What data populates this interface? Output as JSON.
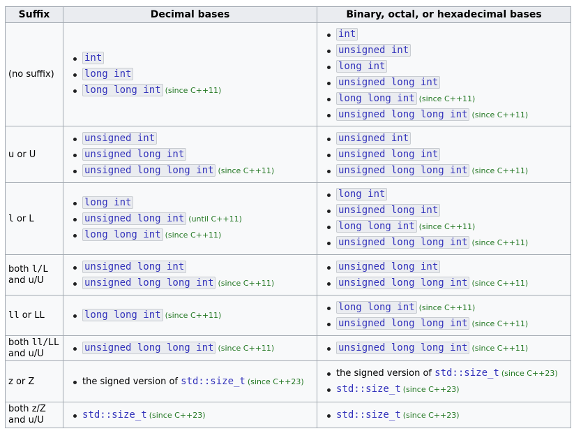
{
  "header": {
    "suffix": "Suffix",
    "decimal": "Decimal bases",
    "other": "Binary, octal, or hexadecimal bases"
  },
  "rows": [
    {
      "suffix_text": "(no suffix)",
      "decimal": [
        {
          "code": "int"
        },
        {
          "code": "long int"
        },
        {
          "code": "long long int",
          "note": "(since C++11)"
        }
      ],
      "other": [
        {
          "code": "int"
        },
        {
          "code": "unsigned int"
        },
        {
          "code": "long int"
        },
        {
          "code": "unsigned long int"
        },
        {
          "code": "long long int",
          "note": "(since C++11)"
        },
        {
          "code": "unsigned long long int",
          "note": "(since C++11)"
        }
      ]
    },
    {
      "suffix_text": "u or U",
      "decimal": [
        {
          "code": "unsigned int"
        },
        {
          "code": "unsigned long int"
        },
        {
          "code": "unsigned long long int",
          "note": "(since C++11)"
        }
      ],
      "other": [
        {
          "code": "unsigned int"
        },
        {
          "code": "unsigned long int"
        },
        {
          "code": "unsigned long long int",
          "note": "(since C++11)"
        }
      ]
    },
    {
      "suffix_a": "l",
      "suffix_b": " or ",
      "suffix_c": "L",
      "decimal": [
        {
          "code": "long int"
        },
        {
          "code": "unsigned long int",
          "note": "(until C++11)"
        },
        {
          "code": "long long int",
          "note": "(since C++11)"
        }
      ],
      "other": [
        {
          "code": "long int"
        },
        {
          "code": "unsigned long int"
        },
        {
          "code": "long long int",
          "note": "(since C++11)"
        },
        {
          "code": "unsigned long long int",
          "note": "(since C++11)"
        }
      ]
    },
    {
      "suffix_line1_a": "both ",
      "suffix_line1_code": "l/L",
      "suffix_line2": "and u/U",
      "decimal": [
        {
          "code": "unsigned long int"
        },
        {
          "code": "unsigned long long int",
          "note": "(since C++11)"
        }
      ],
      "other": [
        {
          "code": "unsigned long int"
        },
        {
          "code": "unsigned long long int",
          "note": "(since C++11)"
        }
      ]
    },
    {
      "suffix_a": "ll",
      "suffix_b": " or ",
      "suffix_c": "LL",
      "decimal": [
        {
          "code": "long long int",
          "note": "(since C++11)"
        }
      ],
      "other": [
        {
          "code": "long long int",
          "note": "(since C++11)"
        },
        {
          "code": "unsigned long long int",
          "note": "(since C++11)"
        }
      ]
    },
    {
      "suffix_line1_a": "both ",
      "suffix_line1_code": "ll/LL",
      "suffix_line2": "and u/U",
      "decimal": [
        {
          "code": "unsigned long long int",
          "note": "(since C++11)"
        }
      ],
      "other": [
        {
          "code": "unsigned long long int",
          "note": "(since C++11)"
        }
      ]
    },
    {
      "suffix_text": "z or Z",
      "decimal": [
        {
          "text": "the signed version of ",
          "plaincode": "std::size_t",
          "note": "(since C++23)"
        }
      ],
      "other": [
        {
          "text": "the signed version of ",
          "plaincode": "std::size_t",
          "note": "(since C++23)"
        },
        {
          "plaincode": "std::size_t",
          "note": "(since C++23)"
        }
      ]
    },
    {
      "suffix_line1_a": "both ",
      "suffix_line1_plain": "z/Z",
      "suffix_line2": "and u/U",
      "decimal": [
        {
          "plaincode": "std::size_t",
          "note": "(since C++23)"
        }
      ],
      "other": [
        {
          "plaincode": "std::size_t",
          "note": "(since C++23)"
        }
      ]
    }
  ]
}
